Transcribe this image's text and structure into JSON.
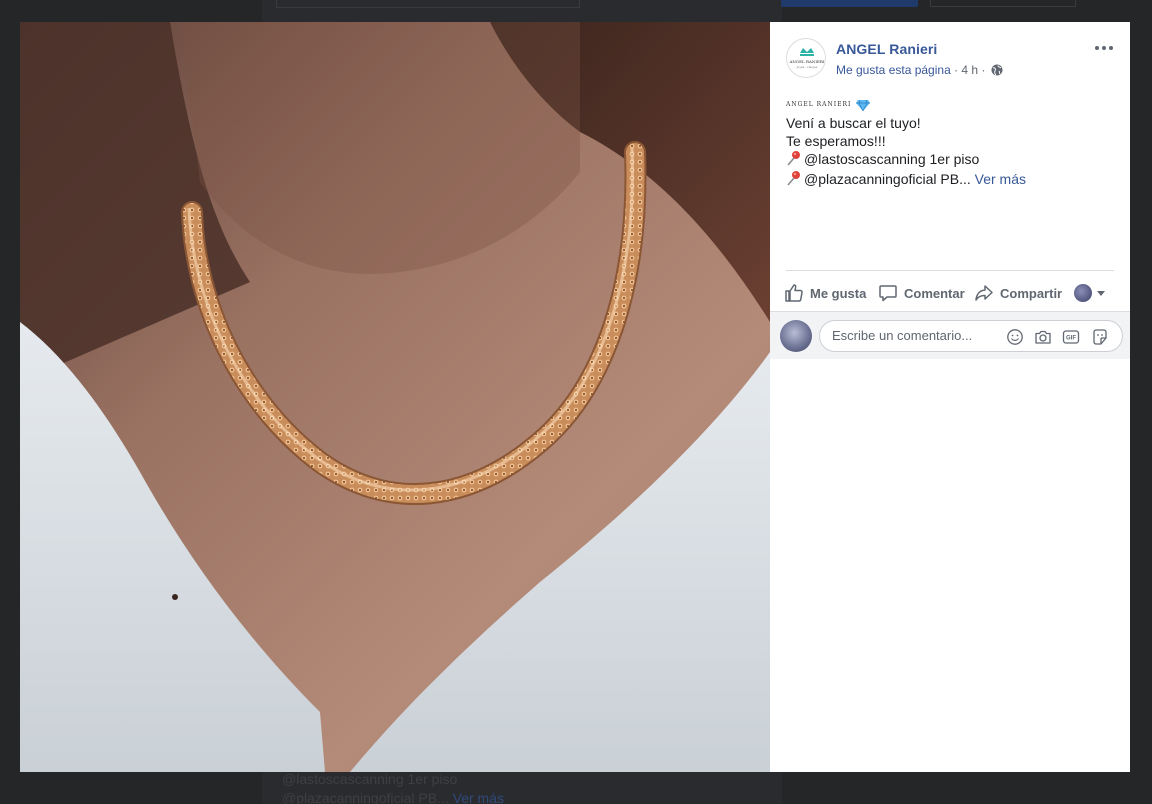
{
  "background_page": {
    "line1": "@lastoscascanning 1er piso",
    "line2": "@plazacanningoficial PB...",
    "line2_more": "Ver más"
  },
  "post": {
    "page_name": "ANGEL Ranieri",
    "avatar_icon": "angel-ranieri-crown-logo",
    "meta": {
      "like_page": "Me gusta esta página",
      "sep1": " · ",
      "time": "4 h",
      "sep2": " · ",
      "privacy_icon": "globe-icon"
    },
    "logo_text": "ANGEL RANIERI",
    "logo_emoji": "gem-icon",
    "lines": [
      "Vení a buscar el tuyo!",
      "Te esperamos!!!",
      "@lastoscascanning 1er piso",
      "@plazacanningoficial PB..."
    ],
    "see_more": "Ver más"
  },
  "actions": {
    "like": "Me gusta",
    "comment": "Comentar",
    "share": "Compartir"
  },
  "comment_box": {
    "placeholder": "Escribe un comentario...",
    "gif_label": "GIF"
  },
  "colors": {
    "link": "#385898",
    "muted": "#606770",
    "divider": "#dadde1",
    "comment_bg": "#f2f3f5"
  }
}
